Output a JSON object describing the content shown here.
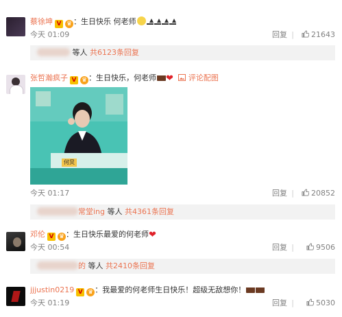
{
  "comments": [
    {
      "username": "蔡徐坤",
      "text": "：生日快乐 何老师",
      "time": "今天 01:09",
      "reply_label": "回复",
      "likes": "21643",
      "sub_reply": {
        "suffix": "等人",
        "link": "共6123条回复"
      }
    },
    {
      "username": "张哲瀚疯子",
      "text": "：生日快乐，何老师",
      "image_link": "评论配图",
      "photo_caption": "何炅",
      "time": "今天 01:17",
      "reply_label": "回复",
      "likes": "20852",
      "sub_reply": {
        "name_visible": "常堂ing",
        "suffix": "等人",
        "link": "共4361条回复"
      }
    },
    {
      "username": "邓伦",
      "text": "：生日快乐最爱的何老师",
      "time": "今天 00:54",
      "reply_label": "回复",
      "likes": "9506",
      "sub_reply": {
        "name_visible": "的",
        "suffix": "等人",
        "link": "共2410条回复"
      }
    },
    {
      "username": "jjjustin0219",
      "text": "：我最爱的何老师生日快乐！超级无敌想你！",
      "time": "今天 01:19",
      "reply_label": "回复",
      "likes": "5030"
    }
  ],
  "separator": "|",
  "icons": {
    "thumb": "thumbs-up-icon",
    "verified": "verified-v-icon",
    "crown": "vip-crown-icon",
    "image": "image-icon"
  },
  "colors": {
    "username": "#eb7350",
    "meta": "#808080",
    "subbox": "#f2f2f2"
  }
}
